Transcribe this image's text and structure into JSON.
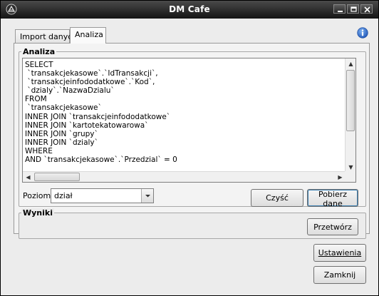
{
  "window": {
    "title": "DM Cafe",
    "titlebar_color": "#1e1e1e"
  },
  "tabs": [
    {
      "label": "Import danych",
      "active": false
    },
    {
      "label": "Analiza",
      "active": true
    }
  ],
  "analiza": {
    "group_title": "Analiza",
    "sql_lines": [
      "SELECT",
      " `transakcjekasowe`.`IdTransakcji`,",
      " `transakcjeinfododatkowe`.`Kod`,",
      " `dzialy`.`NazwaDzialu`",
      "FROM",
      " `transakcjekasowe`",
      "INNER JOIN `transakcjeinfododatkowe`",
      "INNER JOIN `kartotekatowarowa`",
      "INNER JOIN `grupy`",
      "INNER JOIN `dzialy`",
      "WHERE",
      "AND `transakcjekasowe`.`Przedzial` = 0"
    ],
    "poziom_label": "Poziom:",
    "poziom_value": "dział",
    "czysc_label": "Czyść",
    "pobierz_label": "Pobierz dane"
  },
  "wyniki": {
    "group_title": "Wyniki",
    "przetworz_label": "Przetwórz"
  },
  "footer": {
    "ustawienia_label": "Ustawienia",
    "zamknij_label": "Zamknij"
  },
  "icons": {
    "app": "dm-cafe-logo-icon",
    "info": "info-icon",
    "minimize": "minimize-icon",
    "maximize": "maximize-icon",
    "close": "close-icon"
  },
  "colors": {
    "info_blue": "#2a64c8",
    "focus_border": "#3c7fb1"
  }
}
